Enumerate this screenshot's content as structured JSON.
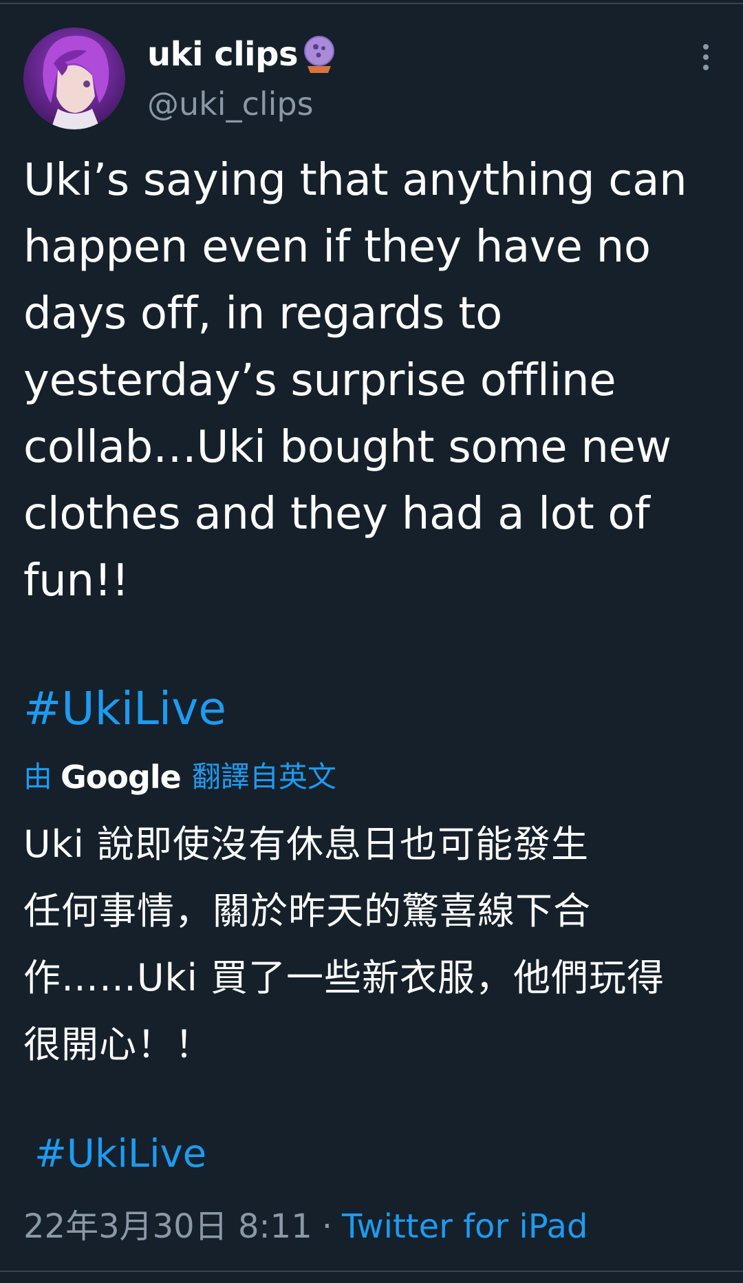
{
  "user": {
    "display_name": "uki clips",
    "handle": "@uki_clips",
    "name_emoji": "crystal-ball-icon",
    "avatar": "avatar"
  },
  "tweet": {
    "text": "Uki’s saying that anything can\nhappen even if they have no\ndays off, in regards to\nyesterday’s surprise offline\ncollab…Uki bought some new\nclothes and they had a lot of\nfun!!",
    "hashtag": "#UkiLive"
  },
  "translation": {
    "by": "由",
    "provider": "Google",
    "translated_from": "翻譯自英文",
    "text": "Uki 說即使沒有休息日也可能發生\n任何事情，關於昨天的驚喜線下合\n作……Uki 買了一些新衣服，他們玩得\n很開心！！",
    "hashtag": "#UkiLive"
  },
  "meta": {
    "timestamp": "22年3月30日 8:11",
    "separator": "·",
    "source": "Twitter for iPad"
  },
  "colors": {
    "background": "#15202b",
    "accent": "#1d9bf0",
    "secondary_text": "#8b98a5",
    "primary_text": "#ffffff"
  }
}
